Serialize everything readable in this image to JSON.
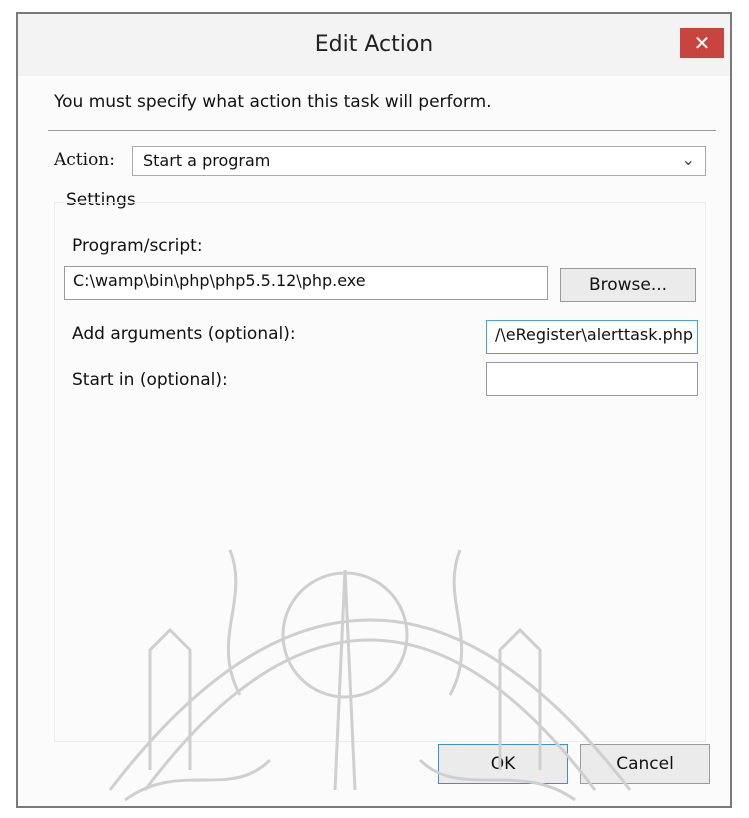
{
  "window": {
    "title": "Edit Action",
    "close_label": "✕"
  },
  "instruction": "You must specify what action this task will perform.",
  "action": {
    "label": "Action:",
    "selected": "Start a program"
  },
  "settings": {
    "label": "Settings",
    "program": {
      "label": "Program/script:",
      "value": "C:\\wamp\\bin\\php\\php5.5.12\\php.exe",
      "browse_label": "Browse..."
    },
    "arguments": {
      "label": "Add arguments (optional):",
      "value": "/\\eRegister\\alerttask.php"
    },
    "start_in": {
      "label": "Start in (optional):",
      "value": ""
    }
  },
  "buttons": {
    "ok": "OK",
    "cancel": "Cancel"
  },
  "colors": {
    "close": "#c8453f",
    "focus": "#4aa0d8",
    "watermark": "#cfcfcf"
  },
  "icons": {
    "close": "close-icon",
    "dropdown": "chevron-down-icon",
    "watermark": "university-seal-watermark"
  }
}
